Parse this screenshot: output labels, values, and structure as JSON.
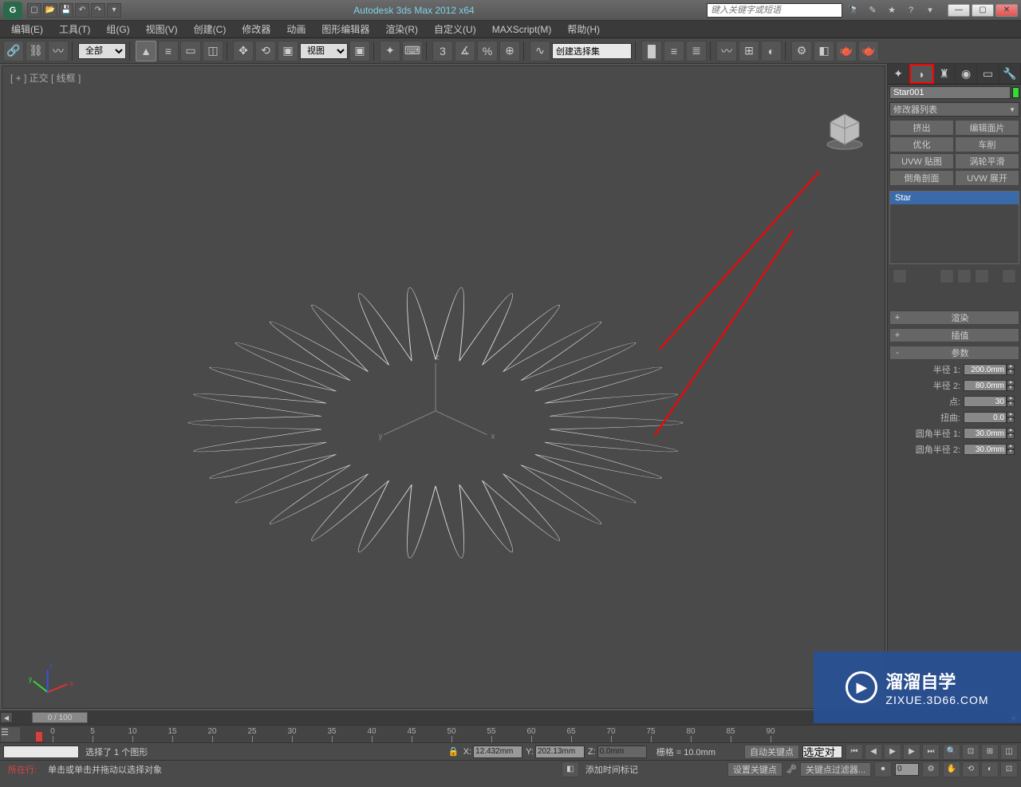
{
  "title": "Autodesk 3ds Max 2012 x64",
  "search_placeholder": "键入关键字或短语",
  "menu": [
    "编辑(E)",
    "工具(T)",
    "组(G)",
    "视图(V)",
    "创建(C)",
    "修改器",
    "动画",
    "图形编辑器",
    "渲染(R)",
    "自定义(U)",
    "MAXScript(M)",
    "帮助(H)"
  ],
  "toolbar": {
    "select_all": "全部",
    "view_mode": "视图",
    "selection_set": "创建选择集"
  },
  "viewport": {
    "label": "[ + ] 正交 [ 线框 ]"
  },
  "command_panel": {
    "object_name": "Star001",
    "modifier_list": "修改器列表",
    "mod_buttons": [
      "挤出",
      "编辑面片",
      "优化",
      "车削",
      "UVW 贴图",
      "涡轮平滑",
      "倒角剖面",
      "UVW 展开"
    ],
    "stack_item": "Star",
    "rollouts": {
      "render": "渲染",
      "interp": "插值",
      "params": "参数"
    },
    "params": {
      "radius1_label": "半径 1:",
      "radius1_value": "200.0mm",
      "radius2_label": "半径 2:",
      "radius2_value": "80.0mm",
      "points_label": "点:",
      "points_value": "30",
      "distortion_label": "扭曲:",
      "distortion_value": "0.0",
      "fillet1_label": "圆角半径 1:",
      "fillet1_value": "30.0mm",
      "fillet2_label": "圆角半径 2:",
      "fillet2_value": "30.0mm"
    }
  },
  "timeline": {
    "slider": "0 / 100",
    "ticks": [
      0,
      5,
      10,
      15,
      20,
      25,
      30,
      35,
      40,
      45,
      50,
      55,
      60,
      65,
      70,
      75,
      80,
      85,
      90
    ]
  },
  "status": {
    "selection_info": "选择了 1 个图形",
    "prompt": "单击或单击并拖动以选择对象",
    "x": "12.432mm",
    "y": "202.13mm",
    "z": "0.0mm",
    "grid": "栅格 = 10.0mm",
    "auto_key": "自动关键点",
    "selected": "选定对",
    "set_key": "设置关键点",
    "key_filter": "关键点过滤器...",
    "add_time_tag": "添加时间标记",
    "frame": "0",
    "location_label": "所在行:"
  },
  "watermark": {
    "brand": "溜溜自学",
    "url": "ZIXUE.3D66.COM"
  }
}
